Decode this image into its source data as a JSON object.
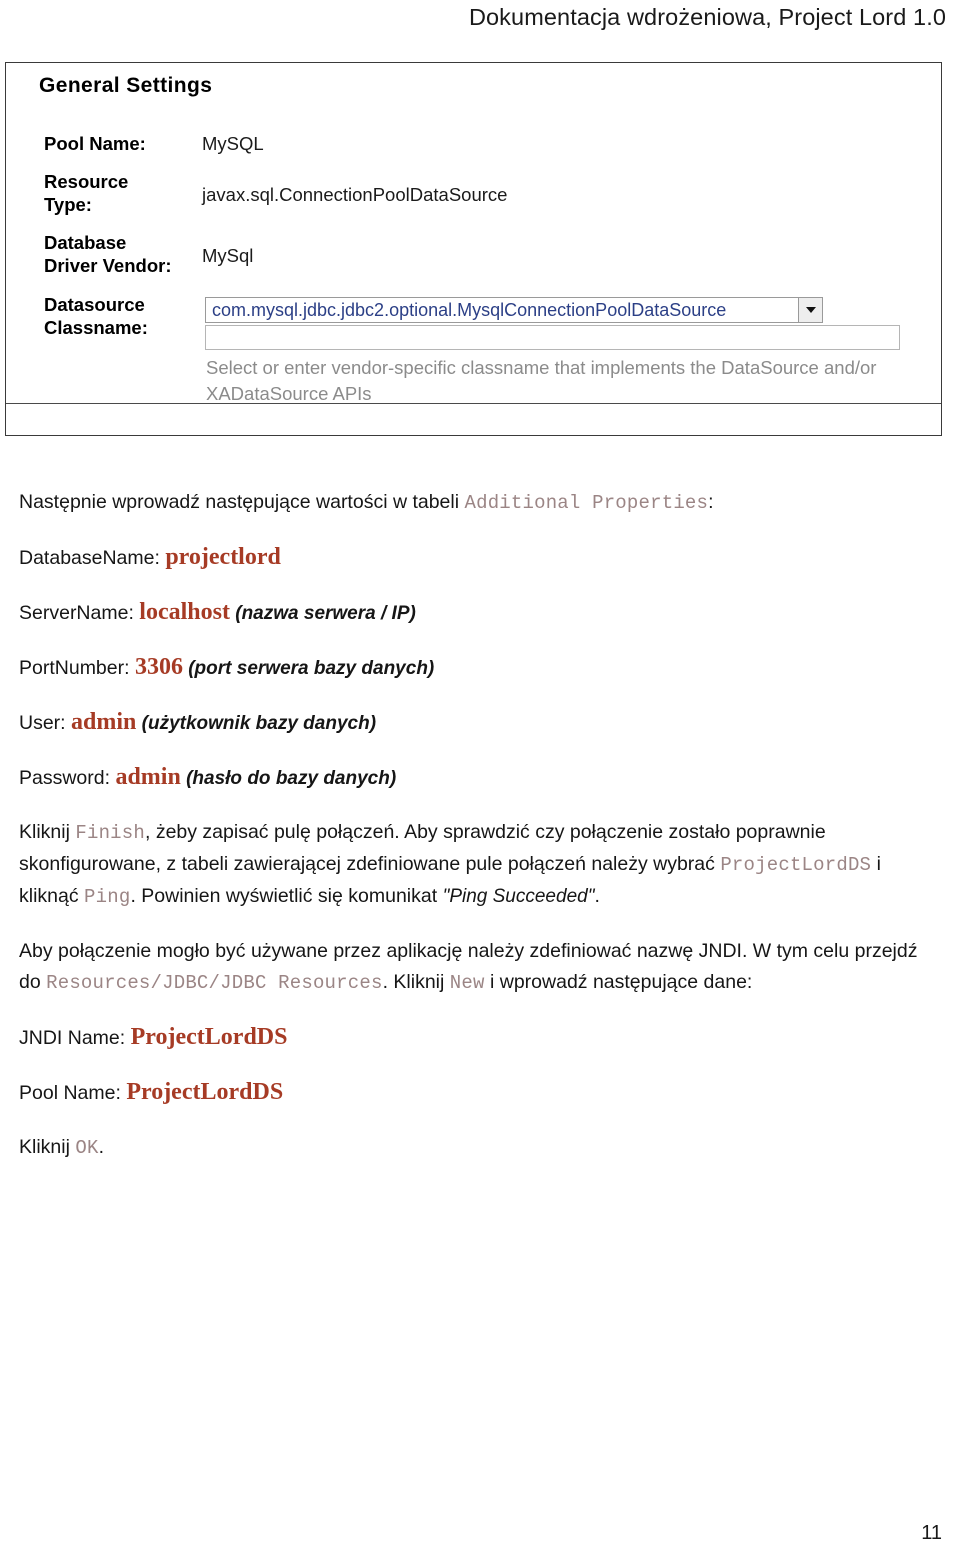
{
  "header": {
    "title": "Dokumentacja wdrożeniowa, Project Lord 1.0"
  },
  "figure": {
    "section_title": "General Settings",
    "rows": [
      {
        "label": "Pool Name:",
        "value": "MySQL"
      },
      {
        "label": "Resource\nType:",
        "value": "javax.sql.ConnectionPoolDataSource"
      },
      {
        "label": "Database\nDriver Vendor:",
        "value": "MySql"
      },
      {
        "label": "Datasource\nClassname:",
        "value": ""
      }
    ],
    "combo_value": "com.mysql.jdbc.jdbc2.optional.MysqlConnectionPoolDataSource",
    "textbox_value": "",
    "hint": "Select or enter vendor-specific classname that implements the DataSource and/or XADataSource APIs",
    "colors": {
      "combo_text": "#2b3f86",
      "hint_text": "#8b8b8b",
      "frame_border": "#3a3a3a"
    }
  },
  "body": {
    "intro_prefix": "Następnie wprowadź następujące wartości w tabeli ",
    "intro_code": "Additional Properties",
    "intro_suffix": ":",
    "properties": [
      {
        "name": "DatabaseName: ",
        "value": "projectlord",
        "note": ""
      },
      {
        "name": "ServerName: ",
        "value": "localhost",
        "note": " (nazwa serwera / IP)"
      },
      {
        "name": "PortNumber: ",
        "value": "3306",
        "note": " (port serwera bazy danych)"
      },
      {
        "name": "User: ",
        "value": "admin",
        "note": " (użytkownik bazy danych)"
      },
      {
        "name": "Password: ",
        "value": "admin",
        "note": " (hasło do bazy danych)"
      }
    ],
    "paragraph_finish": {
      "s1": "Kliknij ",
      "code1": "Finish",
      "s2": ", żeby zapisać pulę połączeń. Aby sprawdzić czy połączenie zostało poprawnie skonfigurowane, z tabeli zawierającej zdefiniowane pule połączeń należy wybrać ",
      "code2": "ProjectLordDS",
      "s3": " i kliknąć ",
      "code3": "Ping",
      "s4": ". Powinien wyświetlić się komunikat ",
      "quote": "\"Ping Succeeded\"",
      "s5": "."
    },
    "paragraph_jndi": {
      "s1": "Aby połączenie mogło być używane przez aplikację należy zdefiniować nazwę JNDI. W tym celu przejdź do ",
      "code1": "Resources/JDBC/JDBC Resources",
      "s2": ". Kliknij ",
      "code2": "New",
      "s3": " i wprowadź następujące dane:"
    },
    "jndi_fields": [
      {
        "name": "JNDI Name: ",
        "value": "ProjectLordDS"
      },
      {
        "name": "Pool Name: ",
        "value": "ProjectLordDS"
      }
    ],
    "final_line": {
      "s1": "Kliknij ",
      "code1": "OK",
      "s2": "."
    },
    "colors": {
      "value_accent": "#a63b25",
      "code_accent": "#9b8585",
      "text": "#161616"
    }
  },
  "footer": {
    "page_number": "11"
  }
}
